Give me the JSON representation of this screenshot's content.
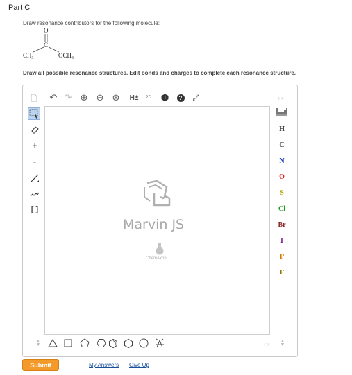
{
  "part_title": "Part C",
  "prompt": "Draw resonance contributors for the following molecule:",
  "molecule": {
    "o": "O",
    "c": "C",
    "ch3": "CH",
    "ch3_sub": "3",
    "och3": "OCH",
    "och3_sub": "3"
  },
  "instructions": "Draw all possible resonance structures. Edit bonds and charges to complete each resonance structure.",
  "toolbar_top": {
    "new_icon": "document-icon",
    "undo": "↶",
    "redo": "↷",
    "zoom_in": "⊕",
    "zoom_out": "⊖",
    "zoom_reset": "⊛",
    "hydrogens_label": "H±",
    "clean2d_label": "2D",
    "info": "●",
    "help": "?",
    "fullscreen": "⤢",
    "arrows": "‹ ›"
  },
  "left_tools": {
    "erase": "◇",
    "plus": "+",
    "minus": "-",
    "bond": "/",
    "chain": "≀",
    "bracket": "[ ]"
  },
  "elements": [
    "H",
    "C",
    "N",
    "O",
    "S",
    "Cl",
    "Br",
    "I",
    "P",
    "F"
  ],
  "element_colors": {
    "H": "#222222",
    "C": "#222222",
    "N": "#1f3fbf",
    "O": "#e01b1b",
    "S": "#b8a200",
    "Cl": "#1d9a1d",
    "Br": "#8b2a2a",
    "I": "#7a1a8a",
    "P": "#d07a00",
    "F": "#8a7a00"
  },
  "watermark": {
    "brand": "Marvin JS",
    "company": "ChemAxon"
  },
  "bottom_shapes": [
    "triangle",
    "square",
    "pentagon",
    "hexagon",
    "hexagon-2",
    "circle",
    "circle-2",
    "bicyclic"
  ],
  "bottom_arrows": "‹ ›",
  "buttons": {
    "submit": "Submit",
    "my_answers": "My Answers",
    "give_up": "Give Up"
  }
}
